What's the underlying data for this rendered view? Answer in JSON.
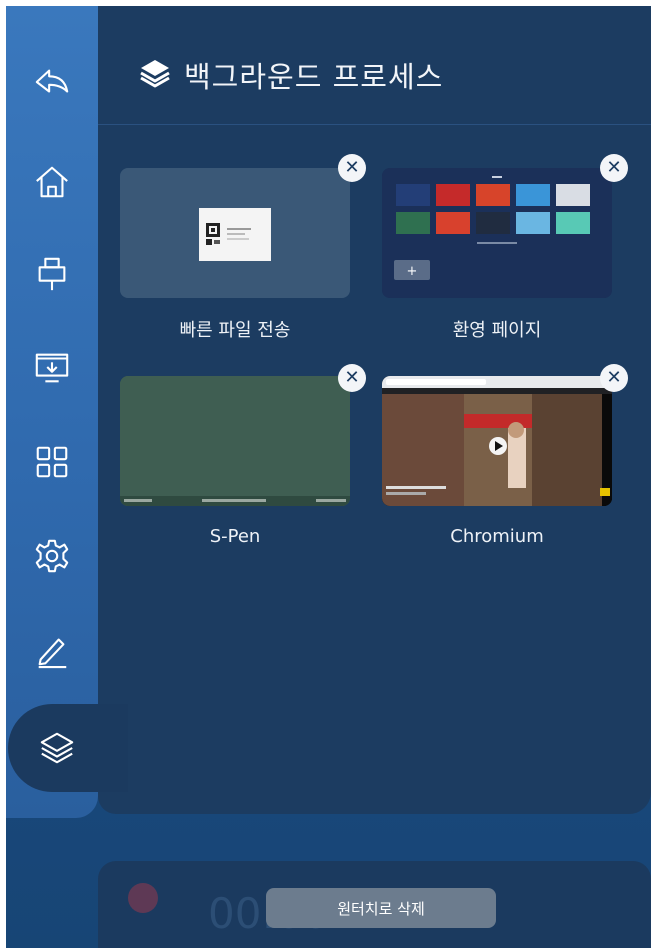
{
  "header": {
    "title": "백그라운드 프로세스",
    "icon": "layers-icon"
  },
  "sidebar": {
    "items": [
      {
        "name": "back",
        "icon": "back-arrow-icon"
      },
      {
        "name": "home",
        "icon": "home-icon"
      },
      {
        "name": "input-source",
        "icon": "input-source-icon"
      },
      {
        "name": "screen-share",
        "icon": "screen-share-icon"
      },
      {
        "name": "apps",
        "icon": "apps-grid-icon"
      },
      {
        "name": "settings",
        "icon": "gear-icon"
      },
      {
        "name": "pen",
        "icon": "pen-icon"
      },
      {
        "name": "background-processes",
        "icon": "layers-icon",
        "active": true
      }
    ]
  },
  "processes": [
    {
      "label": "빠른 파일 전송",
      "thumb": "qr-file-transfer"
    },
    {
      "label": "환영 페이지",
      "thumb": "welcome-page-grid"
    },
    {
      "label": "S-Pen",
      "thumb": "pen-board"
    },
    {
      "label": "Chromium",
      "thumb": "browser-video"
    }
  ],
  "footer": {
    "button_label": "원터치로 삭제",
    "timer": "00:00"
  },
  "colors": {
    "panel": "#1c3c61",
    "sidebar": "#3a78bd",
    "board_green": "#3f5e52"
  }
}
